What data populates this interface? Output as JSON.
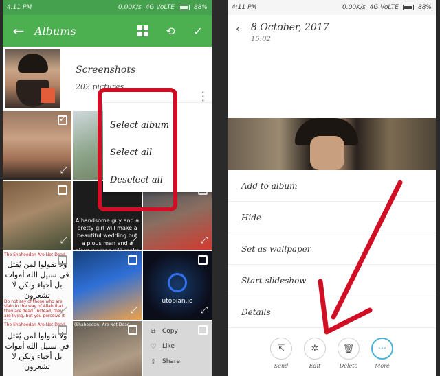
{
  "left": {
    "status": {
      "time": "4:11 PM",
      "speed": "0.00K/s",
      "network": "4G VoLTE",
      "battery": "88%"
    },
    "appbar": {
      "back_icon": "arrow-left-icon",
      "title": "Albums",
      "grid_icon": "grid-icon",
      "history_icon": "history-icon",
      "confirm_icon": "check-icon"
    },
    "album": {
      "name": "Screenshots",
      "count": "202 pictures"
    },
    "dropdown": {
      "items": [
        "Select album",
        "Select all",
        "Deselect all"
      ]
    },
    "cells": {
      "quote": "A handsome guy and a pretty girl will make a beautiful wedding but a pious man and a pious woman will make a beautiful marriage",
      "arabic_1": "ولا تقولوا لمن يُقتل في سبيل الله أموات بل أحياء ولكن لا تشعرون",
      "caption_1": "The Shaheedan Are Not Dead",
      "caption_2": "Do not say of those who are slain in the way of Allah that they are dead. Instead, they are living, but you perceive it not.",
      "arabic_2": "ولا تقولوا لمن يُقتل في سبيل الله أموات بل أحياء ولكن لا تشعرون",
      "caption_3": "The Shaheedan Are Not Dead",
      "caption_4": "(Shaheedan) Are Not Dead",
      "utopian": "utopian.io",
      "context": [
        {
          "icon": "copy-icon",
          "label": "Copy"
        },
        {
          "icon": "heart-icon",
          "label": "Like"
        },
        {
          "icon": "share-icon",
          "label": "Share"
        }
      ]
    }
  },
  "right": {
    "status": {
      "time": "4:11 PM",
      "speed": "0.00K/s",
      "network": "4G VoLTE",
      "battery": "88%"
    },
    "header": {
      "back_icon": "chevron-left-icon",
      "date": "8 October, 2017",
      "time": "15:02"
    },
    "menu": [
      "Add to album",
      "Hide",
      "Set as wallpaper",
      "Start slideshow",
      "Details"
    ],
    "actions": [
      {
        "icon": "share-icon",
        "label": "Send"
      },
      {
        "icon": "edit-icon",
        "label": "Edit"
      },
      {
        "icon": "trash-icon",
        "label": "Delete"
      },
      {
        "icon": "more-icon",
        "label": "More"
      }
    ]
  },
  "colors": {
    "appbar": "#4caf50",
    "highlight": "#d10f24",
    "more_accent": "#49b5d6"
  }
}
